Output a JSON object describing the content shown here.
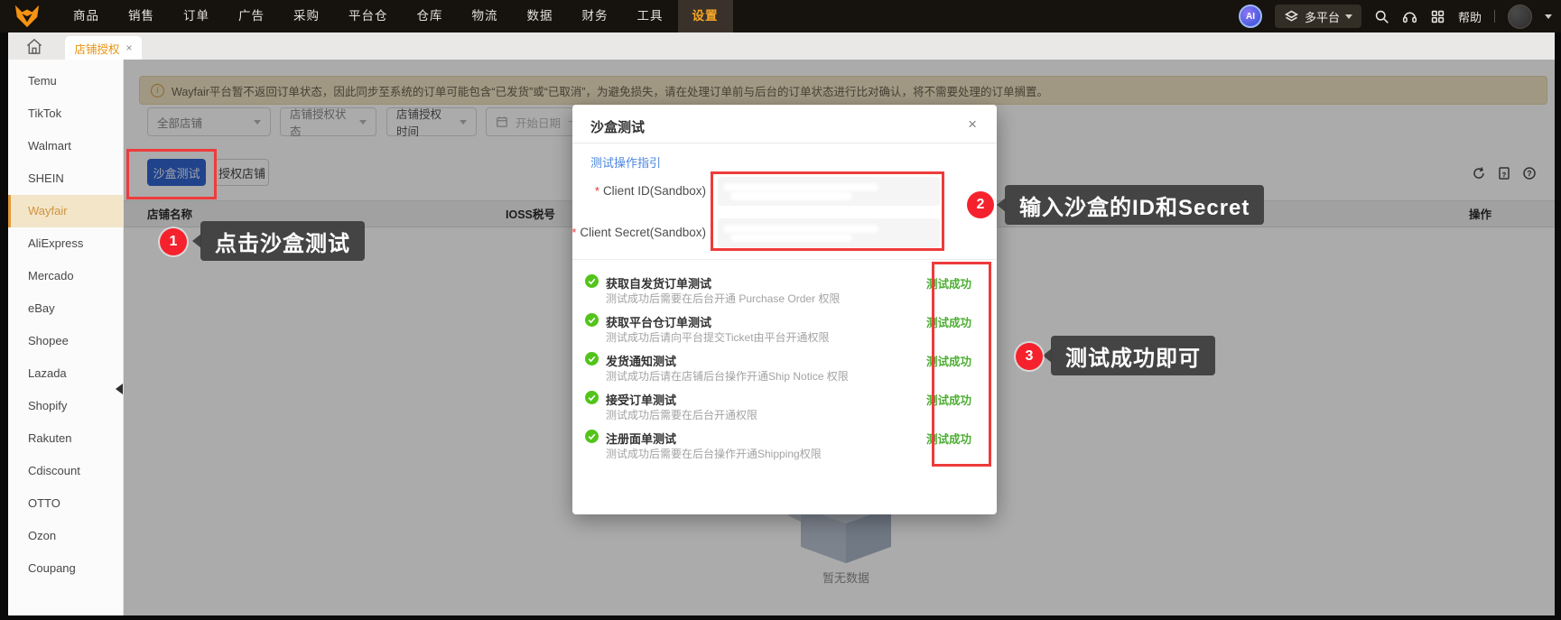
{
  "topbar": {
    "menu": [
      "商品",
      "销售",
      "订单",
      "广告",
      "采购",
      "平台仓",
      "仓库",
      "物流",
      "数据",
      "财务",
      "工具",
      "设置"
    ],
    "active_menu": "设置",
    "ai_badge": "AI",
    "platform_selector": "多平台",
    "help_label": "帮助"
  },
  "tabbar": {
    "active_tab": "店铺授权",
    "close": "×"
  },
  "sidebar": {
    "items": [
      "Temu",
      "TikTok",
      "Walmart",
      "SHEIN",
      "Wayfair",
      "AliExpress",
      "Mercado",
      "eBay",
      "Shopee",
      "Lazada",
      "Shopify",
      "Rakuten",
      "Cdiscount",
      "OTTO",
      "Ozon",
      "Coupang"
    ],
    "active": "Wayfair"
  },
  "banner": {
    "info_icon": "i",
    "text": "Wayfair平台暂不返回订单状态，因此同步至系统的订单可能包含“已发货”或“已取消”，为避免损失，请在处理订单前与后台的订单状态进行比对确认，将不需要处理的订单搁置。"
  },
  "filters": {
    "shop": "全部店铺",
    "auth_status": "店铺授权状态",
    "auth_time": "店铺授权时间",
    "date_start": "开始日期",
    "range_sep": "~"
  },
  "actions": {
    "sandbox_test": "沙盒测试",
    "authorize_shop": "授权店铺"
  },
  "table": {
    "col_shop_name": "店铺名称",
    "col_ioss": "IOSS税号",
    "col_op": "操作",
    "empty_text": "暂无数据"
  },
  "modal": {
    "title": "沙盒测试",
    "close": "×",
    "guide_link": "测试操作指引",
    "required_mark": "*",
    "field_id_label": "Client ID(Sandbox)",
    "field_secret_label": "Client Secret(Sandbox)",
    "tests": [
      {
        "name": "获取自发货订单测试",
        "desc": "测试成功后需要在后台开通 Purchase Order 权限",
        "status": "测试成功"
      },
      {
        "name": "获取平台仓订单测试",
        "desc": "测试成功后请向平台提交Ticket由平台开通权限",
        "status": "测试成功"
      },
      {
        "name": "发货通知测试",
        "desc": "测试成功后请在店铺后台操作开通Ship Notice 权限",
        "status": "测试成功"
      },
      {
        "name": "接受订单测试",
        "desc": "测试成功后需要在后台开通权限",
        "status": "测试成功"
      },
      {
        "name": "注册面单测试",
        "desc": "测试成功后需要在后台操作开通Shipping权限",
        "status": "测试成功"
      }
    ]
  },
  "annotations": {
    "step1": {
      "num": "1",
      "text": "点击沙盒测试"
    },
    "step2": {
      "num": "2",
      "text": "输入沙盒的ID和Secret"
    },
    "step3": {
      "num": "3",
      "text": "测试成功即可"
    }
  },
  "colors": {
    "accent_orange": "#f6a627",
    "primary_blue": "#3064cf",
    "annotation_red": "#ee3b3b",
    "success_green": "#4cae32"
  }
}
